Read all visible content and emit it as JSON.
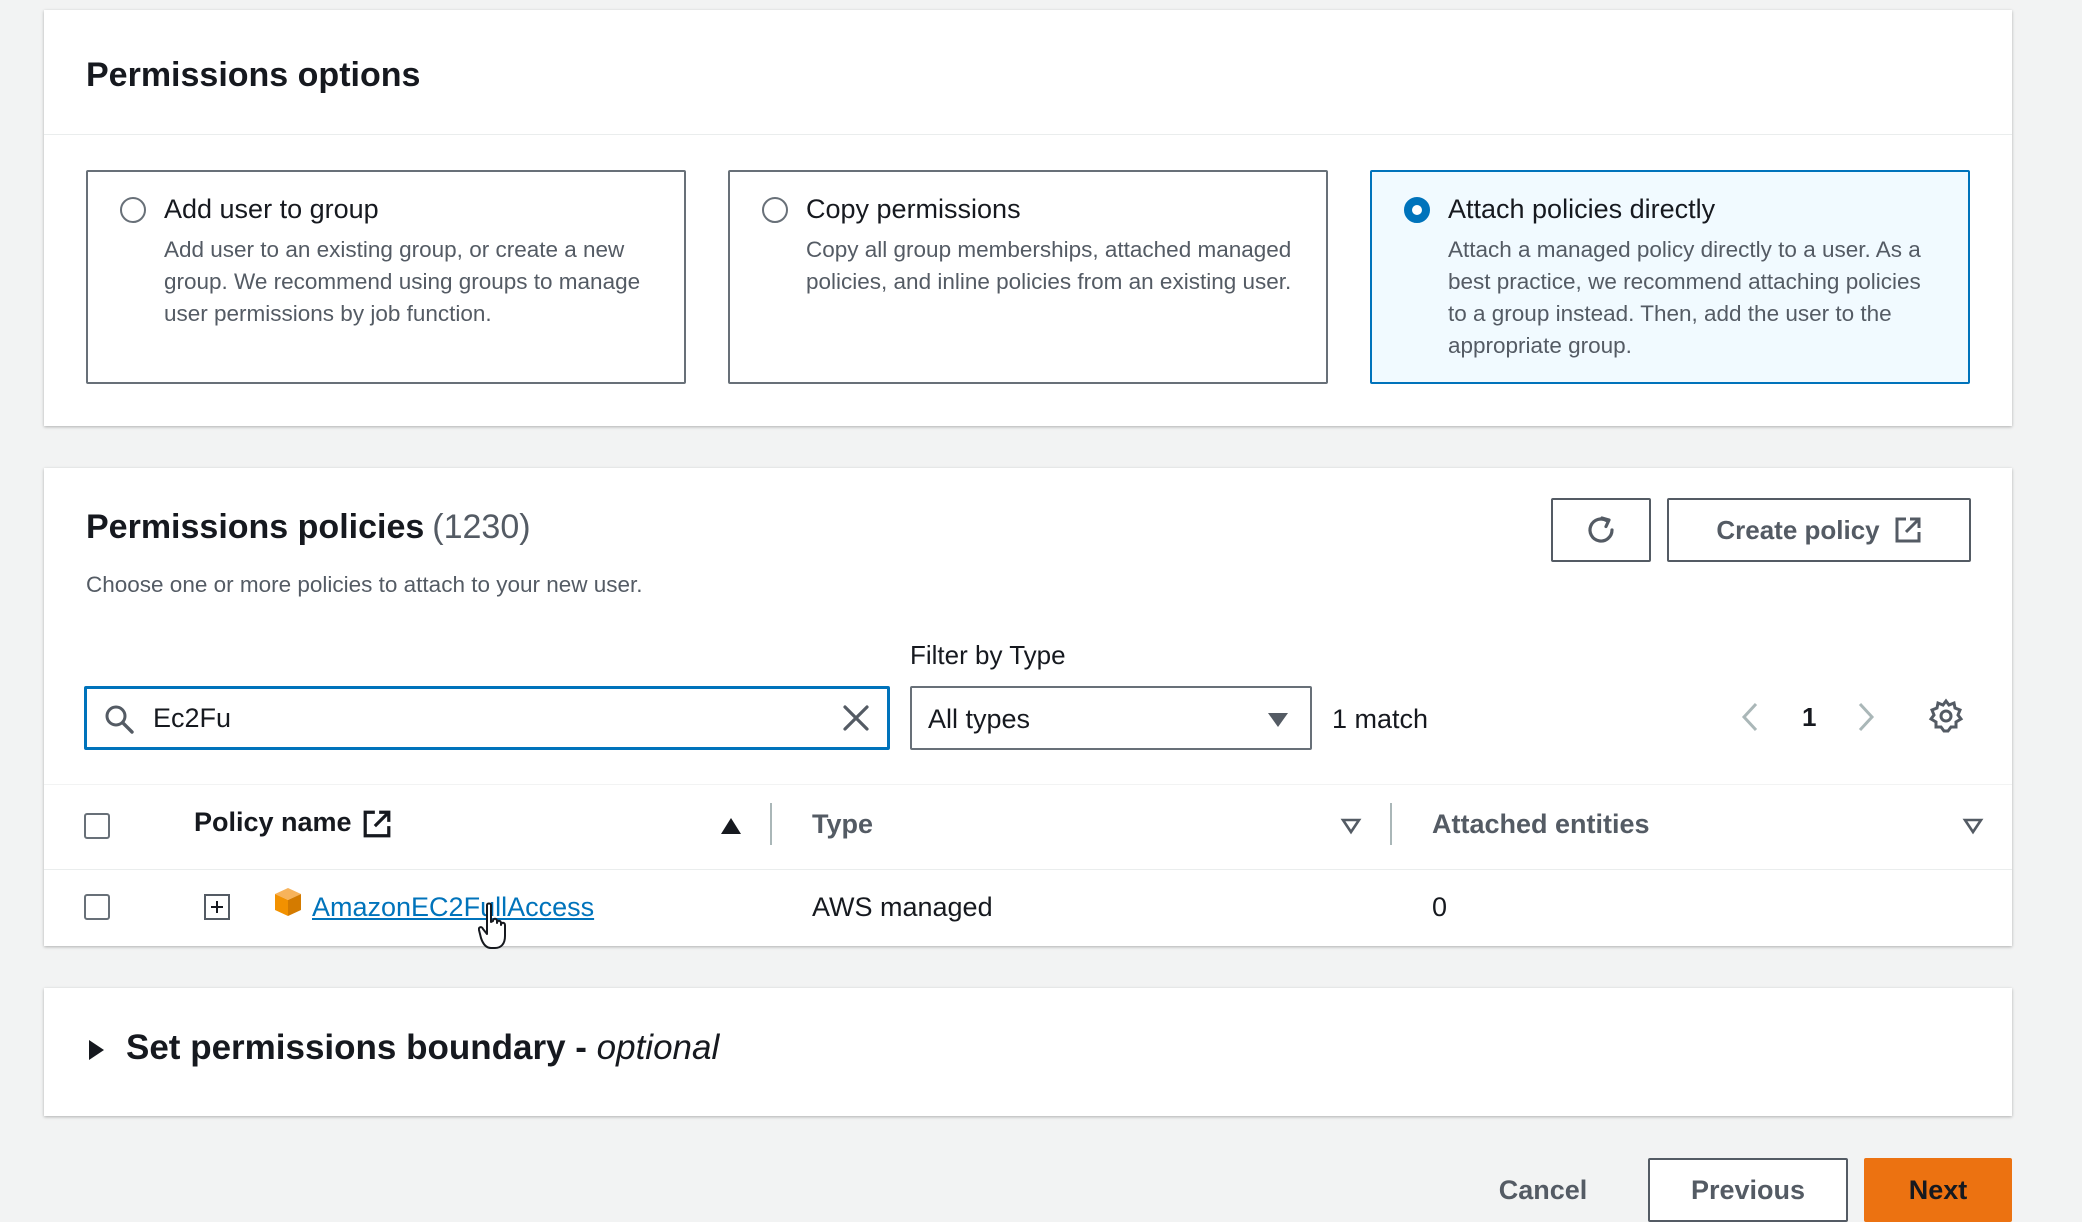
{
  "permissions_options": {
    "title": "Permissions options",
    "options": [
      {
        "label": "Add user to group",
        "description": "Add user to an existing group, or create a new group. We recommend using groups to manage user permissions by job function.",
        "selected": false
      },
      {
        "label": "Copy permissions",
        "description": "Copy all group memberships, attached managed policies, and inline policies from an existing user.",
        "selected": false
      },
      {
        "label": "Attach policies directly",
        "description": "Attach a managed policy directly to a user. As a best practice, we recommend attaching policies to a group instead. Then, add the user to the appropriate group.",
        "selected": true
      }
    ]
  },
  "permissions_policies": {
    "title": "Permissions policies",
    "count": "(1230)",
    "subtitle": "Choose one or more policies to attach to your new user.",
    "refresh_icon": "refresh-icon",
    "create_policy_label": "Create policy",
    "search": {
      "value": "Ec2Fu"
    },
    "filter": {
      "label": "Filter by Type",
      "selected": "All types"
    },
    "match_text": "1 match",
    "page": "1",
    "columns": {
      "policy_name": "Policy name",
      "type": "Type",
      "attached_entities": "Attached entities"
    },
    "rows": [
      {
        "name": "AmazonEC2FullAccess",
        "type": "AWS managed",
        "attached": "0",
        "icon": "aws-managed-cube-icon"
      }
    ]
  },
  "boundary": {
    "title": "Set permissions boundary - ",
    "optional": "optional"
  },
  "footer": {
    "cancel": "Cancel",
    "previous": "Previous",
    "next": "Next"
  },
  "colors": {
    "accent": "#0073bb",
    "primary_button": "#ec7211",
    "cube": "#f29100"
  }
}
